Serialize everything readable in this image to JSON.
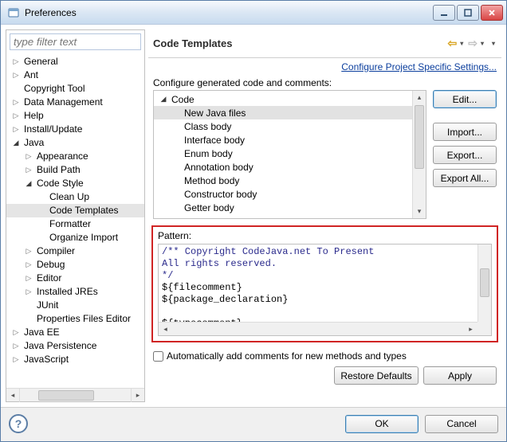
{
  "window": {
    "title": "Preferences"
  },
  "filter": {
    "placeholder": "type filter text"
  },
  "tree": {
    "items": [
      {
        "depth": 0,
        "arrow": "right",
        "label": "General"
      },
      {
        "depth": 0,
        "arrow": "right",
        "label": "Ant"
      },
      {
        "depth": 0,
        "arrow": "none",
        "label": "Copyright Tool"
      },
      {
        "depth": 0,
        "arrow": "right",
        "label": "Data Management"
      },
      {
        "depth": 0,
        "arrow": "right",
        "label": "Help"
      },
      {
        "depth": 0,
        "arrow": "right",
        "label": "Install/Update"
      },
      {
        "depth": 0,
        "arrow": "down",
        "label": "Java"
      },
      {
        "depth": 1,
        "arrow": "right",
        "label": "Appearance"
      },
      {
        "depth": 1,
        "arrow": "right",
        "label": "Build Path"
      },
      {
        "depth": 1,
        "arrow": "down",
        "label": "Code Style"
      },
      {
        "depth": 2,
        "arrow": "none",
        "label": "Clean Up"
      },
      {
        "depth": 2,
        "arrow": "none",
        "label": "Code Templates",
        "selected": true
      },
      {
        "depth": 2,
        "arrow": "none",
        "label": "Formatter"
      },
      {
        "depth": 2,
        "arrow": "none",
        "label": "Organize Import"
      },
      {
        "depth": 1,
        "arrow": "right",
        "label": "Compiler"
      },
      {
        "depth": 1,
        "arrow": "right",
        "label": "Debug"
      },
      {
        "depth": 1,
        "arrow": "right",
        "label": "Editor"
      },
      {
        "depth": 1,
        "arrow": "right",
        "label": "Installed JREs"
      },
      {
        "depth": 1,
        "arrow": "none",
        "label": "JUnit"
      },
      {
        "depth": 1,
        "arrow": "none",
        "label": "Properties Files Editor"
      },
      {
        "depth": 0,
        "arrow": "right",
        "label": "Java EE"
      },
      {
        "depth": 0,
        "arrow": "right",
        "label": "Java Persistence"
      },
      {
        "depth": 0,
        "arrow": "right",
        "label": "JavaScript"
      }
    ]
  },
  "header": {
    "title": "Code Templates"
  },
  "link": {
    "text": "Configure Project Specific Settings..."
  },
  "configure_label": "Configure generated code and comments:",
  "templates": {
    "items": [
      {
        "depth": 0,
        "arrow": "down",
        "label": "Code"
      },
      {
        "depth": 1,
        "arrow": "none",
        "label": "New Java files",
        "selected": true
      },
      {
        "depth": 1,
        "arrow": "none",
        "label": "Class body"
      },
      {
        "depth": 1,
        "arrow": "none",
        "label": "Interface body"
      },
      {
        "depth": 1,
        "arrow": "none",
        "label": "Enum body"
      },
      {
        "depth": 1,
        "arrow": "none",
        "label": "Annotation body"
      },
      {
        "depth": 1,
        "arrow": "none",
        "label": "Method body"
      },
      {
        "depth": 1,
        "arrow": "none",
        "label": "Constructor body"
      },
      {
        "depth": 1,
        "arrow": "none",
        "label": "Getter body"
      }
    ]
  },
  "buttons": {
    "edit": "Edit...",
    "import": "Import...",
    "export": "Export...",
    "export_all": "Export All...",
    "restore": "Restore Defaults",
    "apply": "Apply",
    "ok": "OK",
    "cancel": "Cancel"
  },
  "pattern": {
    "label": "Pattern:",
    "lines": [
      "/** Copyright CodeJava.net To Present",
      "All rights reserved.",
      "*/",
      "${filecomment}",
      "${package_declaration}",
      "",
      "${typecomment}"
    ]
  },
  "auto_checkbox": {
    "label": "Automatically add comments for new methods and types",
    "checked": false
  },
  "help_glyph": "?"
}
